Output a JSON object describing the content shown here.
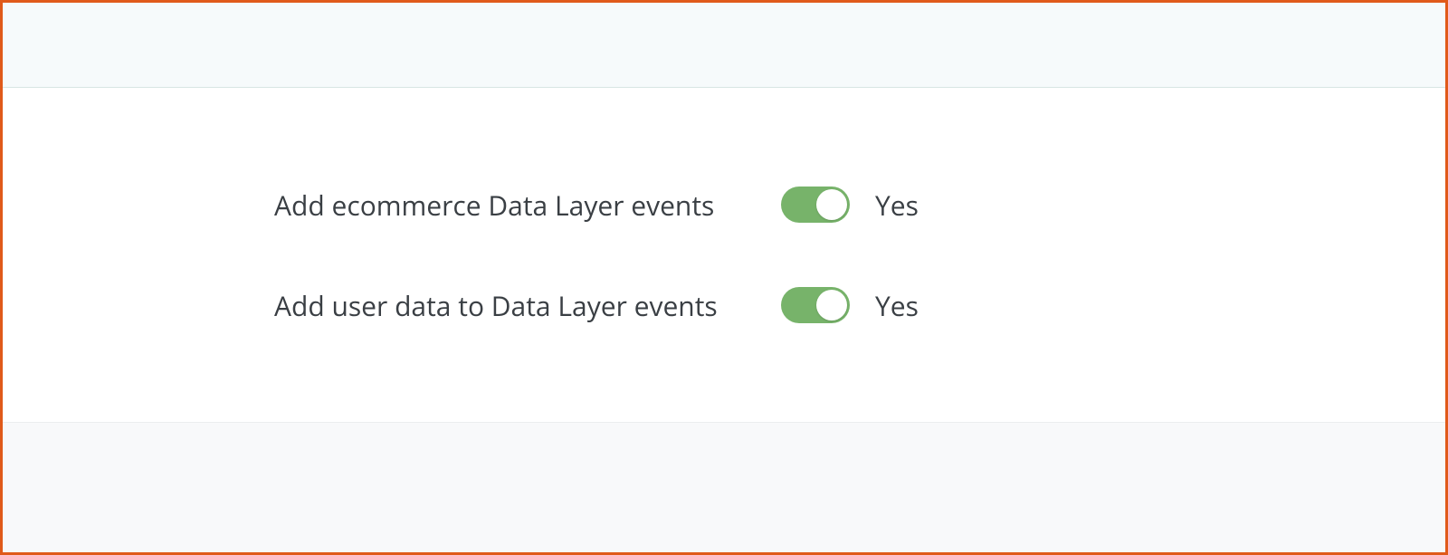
{
  "colors": {
    "frame_border": "#e05a1a",
    "toggle_on_bg": "#77b36a",
    "header_bg": "#f6fafb",
    "footer_bg": "#f8f9fa"
  },
  "settings": {
    "ecommerce_events": {
      "label": "Add ecommerce Data Layer events",
      "state_label": "Yes",
      "enabled": true
    },
    "user_data_events": {
      "label": "Add user data to Data Layer events",
      "state_label": "Yes",
      "enabled": true
    }
  }
}
